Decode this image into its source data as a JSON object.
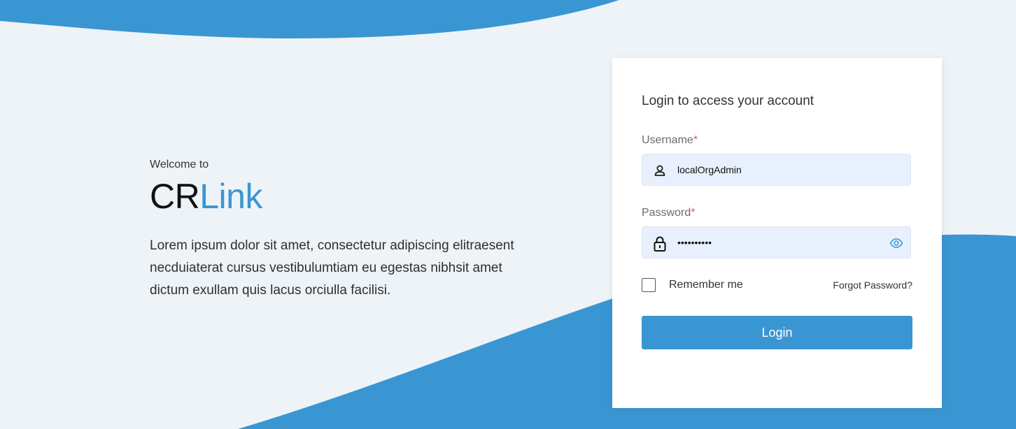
{
  "colors": {
    "accent": "#3a96d2",
    "background": "#eef3f7",
    "input_bg": "#e8f0fd",
    "required": "#e05a5a"
  },
  "hero": {
    "welcome": "Welcome to",
    "brand_part1": "CR",
    "brand_part2": "Link",
    "description": "Lorem ipsum dolor sit amet, consectetur adipiscing elitraesent necduiaterat cursus vestibulumtiam eu egestas nibhsit amet dictum exullam quis lacus orciulla facilisi."
  },
  "login": {
    "title": "Login to access your account",
    "username": {
      "label": "Username",
      "required_mark": "*",
      "value": "localOrgAdmin",
      "icon": "user-icon"
    },
    "password": {
      "label": "Password",
      "required_mark": "*",
      "value": "••••••••••",
      "icon": "lock-icon",
      "toggle_icon": "eye-icon"
    },
    "remember_me": {
      "label": "Remember me",
      "checked": false
    },
    "forgot_password": "Forgot Password?",
    "submit_label": "Login"
  }
}
